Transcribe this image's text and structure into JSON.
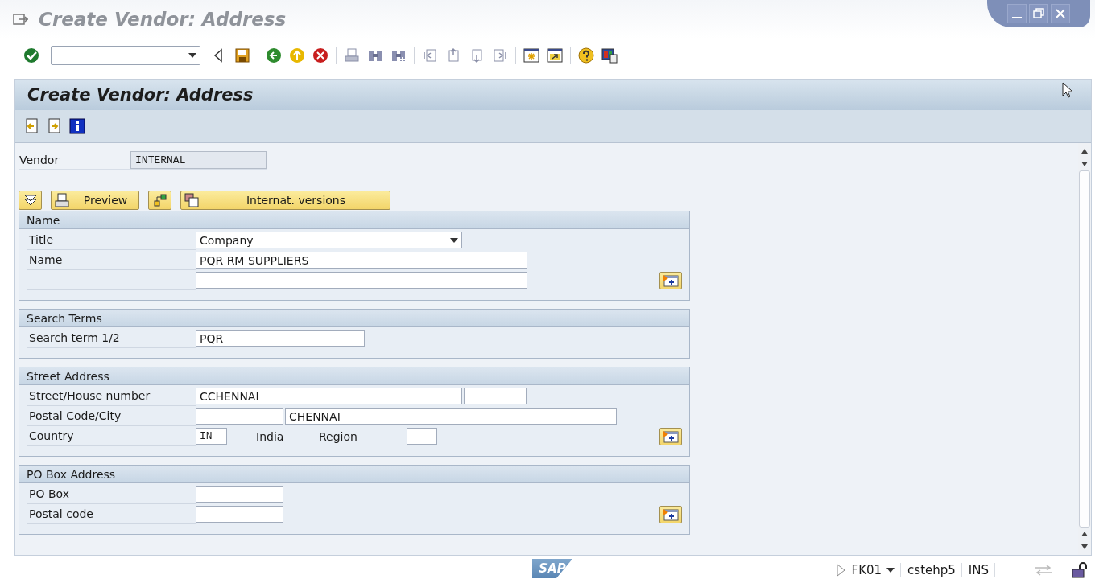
{
  "window": {
    "title": "Create Vendor: Address"
  },
  "screen_title": "Create Vendor: Address",
  "vendor": {
    "label": "Vendor",
    "value": "INTERNAL"
  },
  "buttons": [
    {
      "kind": "expand"
    },
    {
      "kind": "preview",
      "label": "Preview"
    },
    {
      "kind": "org"
    },
    {
      "kind": "versions",
      "label": "Internat. versions"
    }
  ],
  "sections": [
    {
      "title": "Name",
      "more_button": true,
      "rows": [
        {
          "label": "Title",
          "fields": [
            {
              "kind": "dropdown",
              "value": "Company"
            }
          ]
        },
        {
          "label": "Name",
          "fields": [
            {
              "kind": "long",
              "value": "PQR RM SUPPLIERS"
            }
          ]
        },
        {
          "fields": [
            {
              "kind": "long"
            }
          ]
        }
      ]
    },
    {
      "title": "Search Terms",
      "more_button": false,
      "rows": [
        {
          "label": "Search term 1/2",
          "fields": [
            {
              "kind": "medium",
              "value": "PQR"
            }
          ]
        }
      ]
    },
    {
      "title": "Street Address",
      "more_button": true,
      "rows": [
        {
          "label": "Street/House number",
          "fields": [
            {
              "kind": "wide",
              "value": "CCHENNAI"
            },
            {
              "kind": "small"
            }
          ]
        },
        {
          "label": "Postal Code/City",
          "fields": [
            {
              "kind": "short"
            },
            {
              "kind": "long",
              "value": "CHENNAI"
            }
          ]
        },
        {
          "label": "Country",
          "fields": [
            {
              "kind": "code",
              "value": "IN"
            },
            {
              "kind": "text",
              "value": "India"
            },
            {
              "kind": "label",
              "value": "Region"
            },
            {
              "kind": "tiny"
            }
          ]
        }
      ]
    },
    {
      "title": "PO Box Address",
      "more_button": true,
      "rows": [
        {
          "label": "PO Box",
          "fields": [
            {
              "kind": "short"
            }
          ]
        },
        {
          "label": "Postal code",
          "fields": [
            {
              "kind": "short"
            }
          ]
        }
      ]
    }
  ],
  "status_bar": {
    "logo": "SAP",
    "transaction": "FK01",
    "server": "cstehp5",
    "mode": "INS"
  }
}
